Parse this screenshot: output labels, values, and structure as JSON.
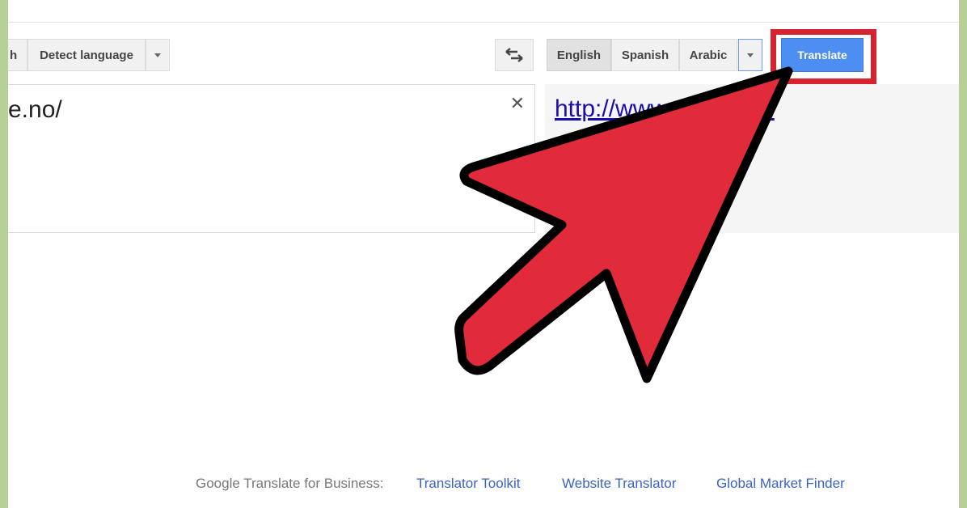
{
  "source_languages": {
    "truncated_label": "h",
    "detect_label": "Detect language"
  },
  "target_languages": {
    "items": [
      "English",
      "Spanish",
      "Arabic"
    ],
    "selected": "English"
  },
  "translate_button": {
    "label": "Translate"
  },
  "source_text": {
    "value": "e.no/"
  },
  "output": {
    "link_text": "http://www.          no/"
  },
  "footer": {
    "label": "Google Translate for Business:",
    "links": [
      "Translator Toolkit",
      "Website Translator",
      "Global Market Finder"
    ]
  },
  "colors": {
    "frame": "#b7cf98",
    "translate_button": "#4c8ef2",
    "highlight_border": "#d6232f",
    "arrow_fill": "#e12b3b",
    "link": "#3a62c2"
  },
  "icons": {
    "swap": "swap-languages-icon",
    "clear": "clear-text-icon",
    "arrow": "red-pointer-arrow"
  }
}
